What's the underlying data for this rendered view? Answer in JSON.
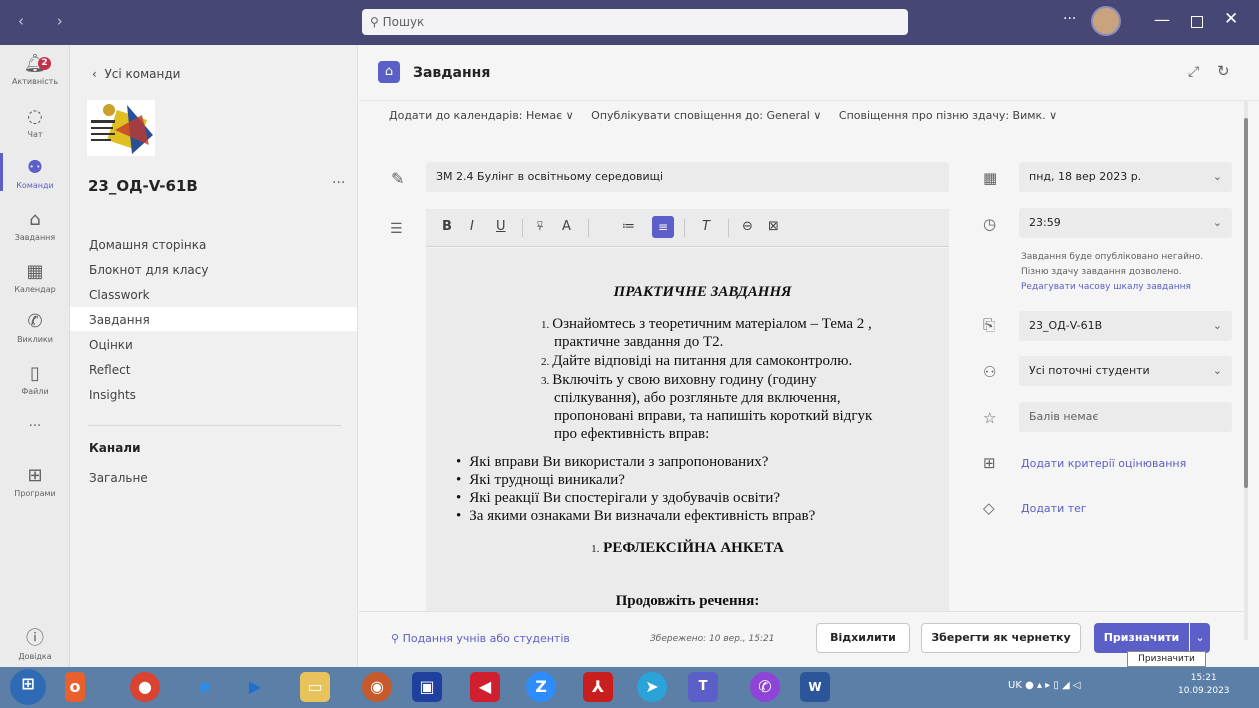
{
  "titlebar": {
    "search_placeholder": "Пошук",
    "more": "···"
  },
  "rail": [
    {
      "label": "Активність",
      "icon": "bell-icon",
      "badge": "2"
    },
    {
      "label": "Чат",
      "icon": "chat-icon"
    },
    {
      "label": "Команди",
      "icon": "teams-icon"
    },
    {
      "label": "Завдання",
      "icon": "assignments-icon"
    },
    {
      "label": "Календар",
      "icon": "calendar-icon"
    },
    {
      "label": "Виклики",
      "icon": "phone-icon"
    },
    {
      "label": "Файли",
      "icon": "file-icon"
    },
    {
      "label": "···",
      "icon": "more-icon"
    },
    {
      "label": "Програми",
      "icon": "apps-icon"
    },
    {
      "label": "Довідка",
      "icon": "help-icon"
    }
  ],
  "sidebar": {
    "back": "Усі команди",
    "team_name": "23_ОД-V-61В",
    "more": "···",
    "links": [
      "Домашня сторінка",
      "Блокнот для класу",
      "Classwork",
      "Завдання",
      "Оцінки",
      "Reflect",
      "Insights"
    ],
    "channels_header": "Канали",
    "channels": [
      "Загальне"
    ]
  },
  "header": {
    "title": "Завдання"
  },
  "options": {
    "calendar": "Додати до календарів: Немає ∨",
    "notify": "Опублікувати сповіщення до: General ∨",
    "late": "Сповіщення про пізню здачу: Вимк. ∨"
  },
  "assignment": {
    "title": "ЗМ 2.4 Булінг в освітньому середовищі",
    "content": {
      "heading": "ПРАКТИЧНЕ ЗАВДАННЯ",
      "numbered": [
        {
          "n": "1.",
          "line1": "Ознайомтесь з теоретичним матеріалом – Тема 2 ,",
          "line2": "практичне завдання до Т2."
        },
        {
          "n": "2.",
          "line1": "Дайте відповіді на питання для самоконтролю."
        },
        {
          "n": "3.",
          "line1": "Включіть у свою виховну годину (годину",
          "line2": "спілкування), або розгляньте для включення,",
          "line3": "пропоновані вправи, та напишіть короткий відгук",
          "line4": "про ефективність вправ:"
        }
      ],
      "bullets": [
        "Які вправи Ви використали з запропонованих?",
        "Які труднощі виникали?",
        "Які реакції Ви спостерігали у здобувачів освіти?",
        "За якими ознаками Ви визначали ефективність вправ?"
      ],
      "section_num": "1.",
      "section": "РЕФЛЕКСІЙНА АНКЕТА",
      "continue": "Продовжіть речення:"
    }
  },
  "right": {
    "date": "пнд, 18 вер 2023 р.",
    "time": "23:59",
    "note1": "Завдання буде опубліковано негайно.",
    "note2": "Пізню здачу завдання дозволено.",
    "edit_timeline": "Редагувати часову шкалу завдання",
    "class": "23_ОД-V-61В",
    "students": "Усі поточні студенти",
    "points": "Балів немає",
    "rubric": "Додати критерії оцінювання",
    "tag": "Додати тег"
  },
  "footer": {
    "submissions": "Подання учнів або студентів",
    "saved": "Збережено: 10 вер., 15:21",
    "discard": "Відхилити",
    "draft": "Зберегти як чернетку",
    "assign": "Призначити",
    "tooltip": "Призначити"
  },
  "taskbar": {
    "lang": "UK",
    "time": "15:21",
    "date": "10.09.2023"
  },
  "colors": {
    "accent": "#5b5fc7",
    "titlebar": "#464775",
    "badge": "#c4314b"
  }
}
